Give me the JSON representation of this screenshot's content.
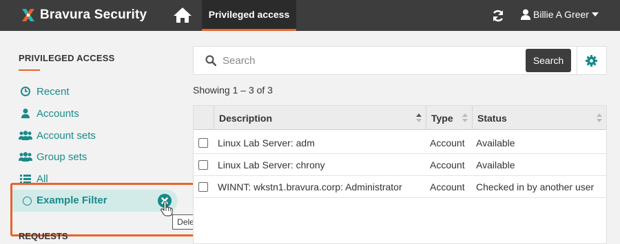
{
  "topbar": {
    "brand": "Bravura Security",
    "nav_tab": "Privileged access",
    "user_name": "Billie A Greer",
    "icons": {
      "home": "home-icon",
      "refresh": "refresh-icon",
      "user": "user-icon",
      "caret": "caret-down-icon"
    }
  },
  "sidebar": {
    "heading": "PRIVILEGED ACCESS",
    "items": [
      {
        "label": "Recent",
        "icon": "clock-icon"
      },
      {
        "label": "Accounts",
        "icon": "user-icon"
      },
      {
        "label": "Account sets",
        "icon": "users-icon"
      },
      {
        "label": "Group sets",
        "icon": "users-icon"
      },
      {
        "label": "All",
        "icon": "list-icon"
      }
    ],
    "filter": {
      "label": "Example Filter",
      "tooltip": "Delete"
    },
    "requests_heading": "REQUESTS"
  },
  "search": {
    "placeholder": "Search",
    "value": "",
    "button": "Search"
  },
  "results": {
    "showing": "Showing 1 – 3 of 3"
  },
  "table": {
    "columns": [
      "Description",
      "Type",
      "Status"
    ],
    "rows": [
      {
        "description": "Linux Lab Server: adm",
        "type": "Account",
        "status": "Available"
      },
      {
        "description": "Linux Lab Server: chrony",
        "type": "Account",
        "status": "Available"
      },
      {
        "description": "WINNT: wkstn1.bravura.corp: Administrator",
        "type": "Account",
        "status": "Checked in by another user"
      }
    ]
  },
  "colors": {
    "accent": "#e8632b",
    "teal": "#1a8a8a",
    "topbar": "#3d3d3d",
    "filter_bg": "#d2ebe9"
  }
}
